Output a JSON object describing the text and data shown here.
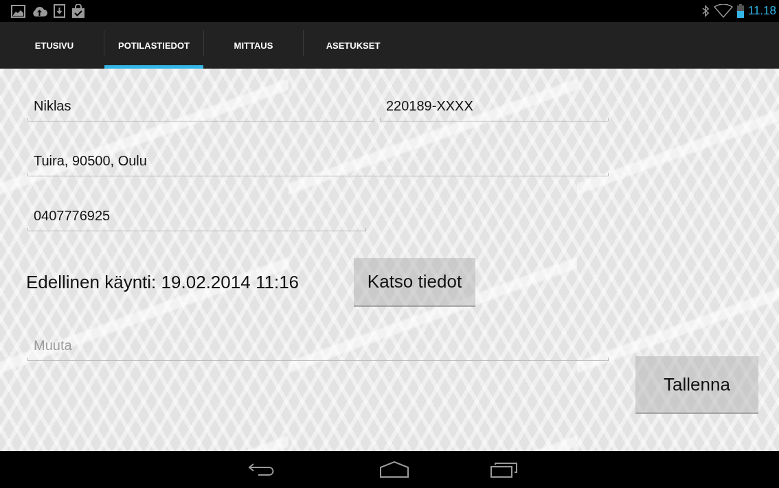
{
  "status_bar": {
    "time": "11.18"
  },
  "tabs": [
    {
      "label": "ETUSIVU",
      "selected": false
    },
    {
      "label": "POTILASTIEDOT",
      "selected": true
    },
    {
      "label": "MITTAUS",
      "selected": false
    },
    {
      "label": "ASETUKSET",
      "selected": false
    }
  ],
  "fields": [
    {
      "value": "Niklas"
    },
    {
      "value": "220189-XXXX"
    },
    {
      "value": "Tuira, 90500, Oulu"
    },
    {
      "value": "0407776925"
    }
  ],
  "last_visit": {
    "text": "Edellinen käynti: 19.02.2014 11:16",
    "button": "Katso tiedot"
  },
  "notes_field": {
    "placeholder": "Muuta"
  },
  "save_button": "Tallenna"
}
